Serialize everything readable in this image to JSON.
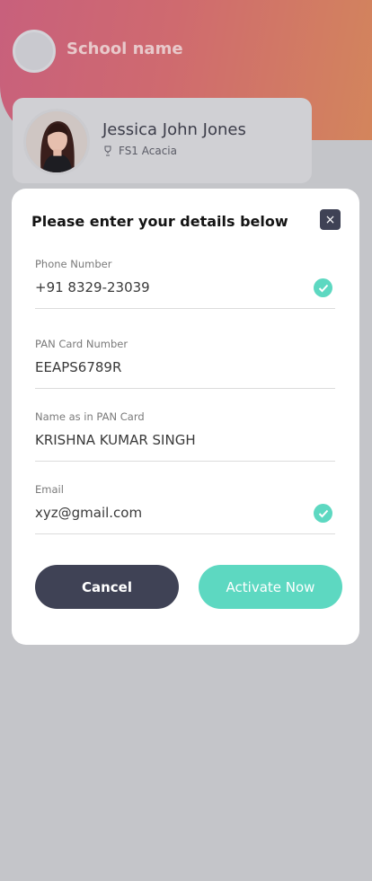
{
  "header": {
    "school_name": "School name"
  },
  "profile": {
    "name": "Jessica John Jones",
    "class": "FS1 Acacia"
  },
  "modal": {
    "title": "Please enter your details below",
    "close_label": "×",
    "fields": [
      {
        "label": "Phone Number",
        "value": "+91 8329-23039",
        "verified": true
      },
      {
        "label": "PAN Card Number",
        "value": "EEAPS6789R",
        "verified": false
      },
      {
        "label": "Name as in PAN Card",
        "value": "KRISHNA KUMAR SINGH",
        "verified": false
      },
      {
        "label": "Email",
        "value": "xyz@gmail.com",
        "verified": true
      }
    ],
    "cancel_label": "Cancel",
    "activate_label": "Activate Now"
  },
  "colors": {
    "accent": "#5dd8c1",
    "dark": "#3f4255",
    "gradient_start": "#c8607c",
    "gradient_end": "#d3855c"
  }
}
